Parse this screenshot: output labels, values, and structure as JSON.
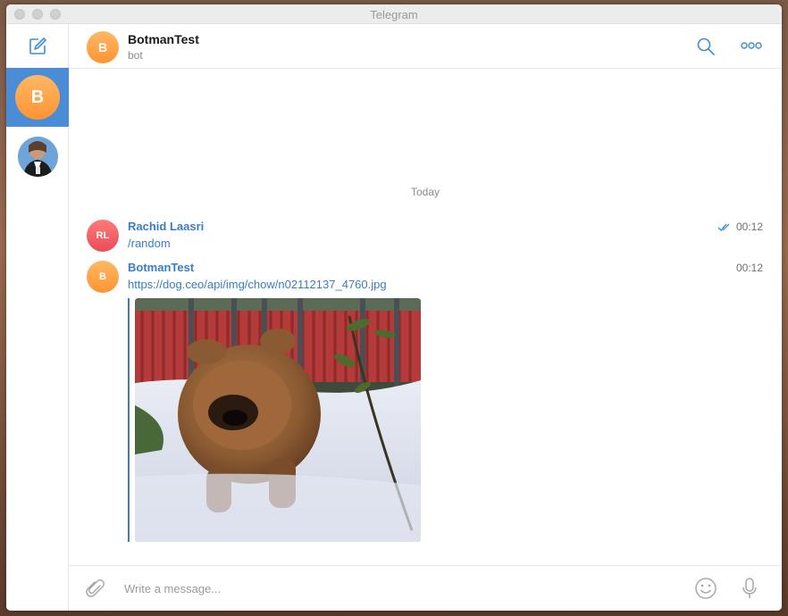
{
  "window": {
    "title": "Telegram"
  },
  "sidebar": {
    "chats": [
      {
        "initial": "B",
        "name": "BotmanTest",
        "active": true
      },
      {
        "avatar": "photo-avatar",
        "active": false
      }
    ]
  },
  "header": {
    "name": "BotmanTest",
    "status": "bot",
    "initial": "B"
  },
  "messages": {
    "date_separator": "Today",
    "items": [
      {
        "author": "Rachid Laasri",
        "initials": "RL",
        "text": "/random",
        "time": "00:12",
        "read": true
      },
      {
        "author": "BotmanTest",
        "initials": "B",
        "text": "https://dog.ceo/api/img/chow/n02112137_4760.jpg",
        "time": "00:12",
        "has_image_preview": true
      }
    ]
  },
  "composer": {
    "placeholder": "Write a message..."
  },
  "colors": {
    "accent": "#3a7dc4",
    "active_chat": "#4a8cd6",
    "bot_avatar": "#ff9f45",
    "user_avatar": "#ef5560"
  },
  "icons": [
    "compose-icon",
    "search-icon",
    "more-icon",
    "attach-icon",
    "emoji-icon",
    "microphone-icon",
    "double-check-icon"
  ]
}
